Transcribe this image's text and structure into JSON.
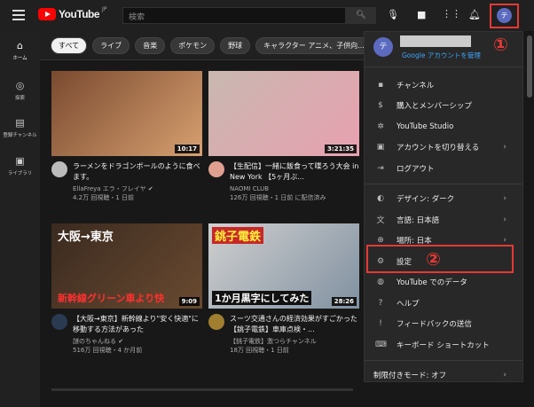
{
  "header": {
    "logo": "YouTube",
    "region": "JP",
    "search_placeholder": "検索",
    "avatar_letter": "テ"
  },
  "sidebar": [
    {
      "icon": "home-icon",
      "glyph": "⌂",
      "label": "ホーム"
    },
    {
      "icon": "explore-icon",
      "glyph": "◎",
      "label": "探索"
    },
    {
      "icon": "subscriptions-icon",
      "glyph": "▤",
      "label": "登録チャンネル"
    },
    {
      "icon": "library-icon",
      "glyph": "▣",
      "label": "ライブラリ"
    }
  ],
  "chips": [
    "すべて",
    "ライブ",
    "音楽",
    "ポケモン",
    "野球",
    "キャラクター アニメ、子供向..."
  ],
  "videos": [
    {
      "title": "ラーメンをドラゴンボールのように食べます。",
      "channel": "EllaFreya エラ・フレイヤ ✔",
      "stats": "4.2万 回視聴・1 日前",
      "duration": "10:17",
      "thumb_text": "",
      "colors": [
        "#7a4a30",
        "#d8a070"
      ],
      "avatar": "#bbb"
    },
    {
      "title": "【生配信】一緒に飯食って喋ろう大会 in New York 【5ヶ月ぶ...",
      "channel": "NAOMI CLUB",
      "stats": "126万 回視聴・1 日前 に配信済み",
      "duration": "3:21:35",
      "thumb_text": "",
      "colors": [
        "#c9b8b0",
        "#e8a0b0"
      ],
      "avatar": "#e0a090"
    },
    {
      "title": "【大阪→東京】新幹線より\"安く快適\"に移動する方法があった",
      "channel": "謎のちゃんねる ✔",
      "stats": "516万 回視聴・4 か月前",
      "duration": "9:09",
      "thumb_text": "大阪→東京",
      "thumb_text2": "新幹線グリーン車より快",
      "colors": [
        "#3a2a20",
        "#6a4a30"
      ],
      "avatar": "#2a3a50"
    },
    {
      "title": "スーツ交通さんの経済効果がすごかった【銚子電鉄】車庫点検・...",
      "channel": "【銚子電鉄】激つらチャンネル",
      "stats": "18万 回視聴・1 日前",
      "duration": "28:26",
      "thumb_text": "銚子電鉄",
      "thumb_text2": "1か月黒字にしてみた",
      "colors": [
        "#d0d0d0",
        "#8090a0"
      ],
      "avatar": "#a08030"
    }
  ],
  "menu": {
    "manage_account": "Google アカウントを管理",
    "group1": [
      {
        "icon": "channel-icon",
        "glyph": "▪",
        "label": "チャンネル"
      },
      {
        "icon": "purchases-icon",
        "glyph": "$",
        "label": "購入とメンバーシップ"
      },
      {
        "icon": "studio-icon",
        "glyph": "✲",
        "label": "YouTube Studio"
      },
      {
        "icon": "switch-account-icon",
        "glyph": "▣",
        "label": "アカウントを切り替える",
        "chevron": true
      },
      {
        "icon": "logout-icon",
        "glyph": "⇥",
        "label": "ログアウト"
      }
    ],
    "group2": [
      {
        "icon": "appearance-icon",
        "glyph": "◐",
        "label": "デザイン: ダーク",
        "chevron": true
      },
      {
        "icon": "language-icon",
        "glyph": "文",
        "label": "言語: 日本語",
        "chevron": true
      },
      {
        "icon": "location-icon",
        "glyph": "⊕",
        "label": "場所: 日本",
        "chevron": true
      },
      {
        "icon": "settings-icon",
        "glyph": "⚙",
        "label": "設定"
      },
      {
        "icon": "your-data-icon",
        "glyph": "◍",
        "label": "YouTube でのデータ"
      },
      {
        "icon": "help-icon",
        "glyph": "?",
        "label": "ヘルプ"
      },
      {
        "icon": "feedback-icon",
        "glyph": "!",
        "label": "フィードバックの送信"
      },
      {
        "icon": "keyboard-icon",
        "glyph": "⌨",
        "label": "キーボード ショートカット"
      }
    ],
    "restricted_mode": "制限付きモード: オフ"
  },
  "annotations": {
    "step1": "①",
    "step2": "②",
    "color": "#e53935"
  }
}
